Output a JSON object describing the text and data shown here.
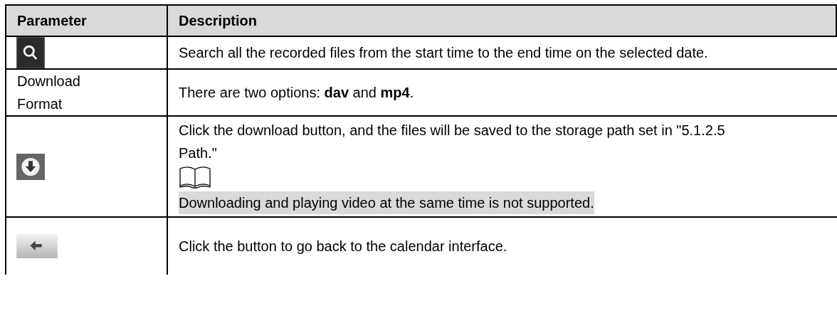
{
  "table": {
    "columns": [
      "Parameter",
      "Description"
    ],
    "rows": [
      {
        "parameter": {
          "kind": "search-icon"
        },
        "description": [
          {
            "kind": "text",
            "text": "Search all the recorded files from the start time to the end time on the selected date."
          }
        ]
      },
      {
        "parameter": {
          "kind": "text",
          "text": "Download Format"
        },
        "description": [
          {
            "kind": "text",
            "text": "There are two options: **dav** and **mp4**."
          }
        ]
      },
      {
        "parameter": {
          "kind": "download-icon"
        },
        "description": [
          {
            "kind": "text",
            "text": "Click the download button, and the files will be saved to the storage path set in \"5.1.2.5 Path.\""
          },
          {
            "kind": "note-icon"
          },
          {
            "kind": "highlighted",
            "text": "Downloading and playing video at the same time is not supported."
          }
        ]
      },
      {
        "parameter": {
          "kind": "back-icon"
        },
        "description": [
          {
            "kind": "text",
            "text": "Click the button to go back to the calendar interface."
          }
        ]
      }
    ]
  }
}
